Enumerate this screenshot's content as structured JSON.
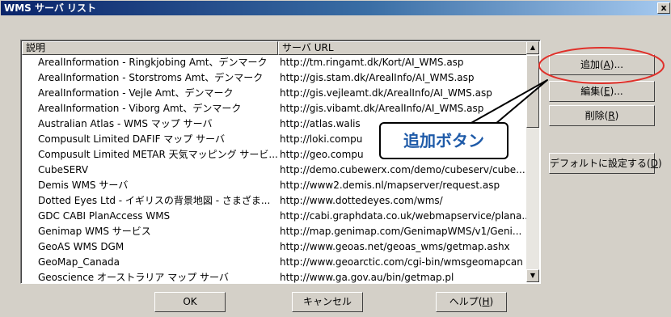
{
  "window": {
    "title": "WMS サーバ リスト",
    "close_label": "x"
  },
  "table": {
    "columns": [
      "説明",
      "サーバ URL"
    ],
    "rows": [
      {
        "desc": "ArealInformation - Ringkjobing Amt、デンマーク",
        "url": "http://tm.ringamt.dk/Kort/AI_WMS.asp"
      },
      {
        "desc": "ArealInformation - Storstroms Amt、デンマーク",
        "url": "http://gis.stam.dk/ArealInfo/AI_WMS.asp"
      },
      {
        "desc": "ArealInformation - Vejle Amt、デンマーク",
        "url": "http://gis.vejleamt.dk/ArealInfo/AI_WMS.asp"
      },
      {
        "desc": "ArealInformation - Viborg Amt、デンマーク",
        "url": "http://gis.vibamt.dk/ArealInfo/AI_WMS.asp"
      },
      {
        "desc": "Australian Atlas - WMS マップ サーバ",
        "url": "http://atlas.walis"
      },
      {
        "desc": "Compusult Limited DAFIF マップ サーバ",
        "url": "http://loki.compu"
      },
      {
        "desc": "Compusult Limited METAR 天気マッピング サービ...",
        "url": "http://geo.compu"
      },
      {
        "desc": "CubeSERV",
        "url": "http://demo.cubewerx.com/demo/cubeserv/cube..."
      },
      {
        "desc": "Demis WMS サーバ",
        "url": "http://www2.demis.nl/mapserver/request.asp"
      },
      {
        "desc": "Dotted Eyes Ltd - イギリスの背景地図 - さまざま...",
        "url": "http://www.dottedeyes.com/wms/"
      },
      {
        "desc": "GDC CABI PlanAccess WMS",
        "url": "http://cabi.graphdata.co.uk/webmapservice/plana..."
      },
      {
        "desc": "Genimap WMS サービス",
        "url": "http://map.genimap.com/GenimapWMS/v1/Geni..."
      },
      {
        "desc": "GeoAS WMS DGM",
        "url": "http://www.geoas.net/geoas_wms/getmap.ashx"
      },
      {
        "desc": "GeoMap_Canada",
        "url": "http://www.geoarctic.com/cgi-bin/wmsgeomapcan"
      },
      {
        "desc": "Geoscience オーストラリア マップ サーバ",
        "url": "http://www.ga.gov.au/bin/getmap.pl"
      }
    ]
  },
  "buttons": {
    "add": {
      "label": "追加(",
      "key": "A",
      "suffix": ")..."
    },
    "edit": {
      "label": "編集(",
      "key": "E",
      "suffix": ")..."
    },
    "delete": {
      "label": "削除(",
      "key": "R",
      "suffix": ")"
    },
    "set_default": {
      "label": "デフォルトに設定する(",
      "key": "D",
      "suffix": ")"
    },
    "ok": {
      "label": "OK"
    },
    "cancel": {
      "label": "キャンセル"
    },
    "help": {
      "label": "ヘルプ(",
      "key": "H",
      "suffix": ")"
    }
  },
  "annotation": {
    "callout_text": "追加ボタン",
    "color": "#e0302a",
    "text_color": "#1e5aa8"
  },
  "icons": {
    "scroll_up": "triangle-up-icon",
    "scroll_down": "triangle-down-icon"
  }
}
